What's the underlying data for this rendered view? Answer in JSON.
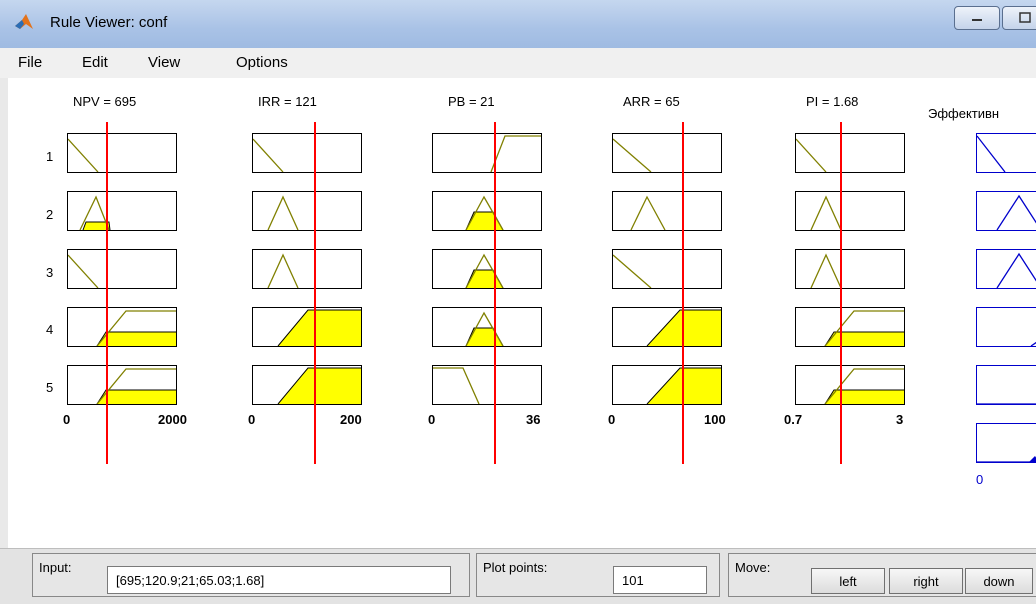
{
  "window": {
    "title": "Rule Viewer: conf"
  },
  "menu": {
    "items": [
      "File",
      "Edit",
      "View",
      "Options"
    ]
  },
  "inputs": [
    {
      "title": "NPV = 695",
      "min": "0",
      "max": "2000"
    },
    {
      "title": "IRR = 121",
      "min": "0",
      "max": "200"
    },
    {
      "title": "PB = 21",
      "min": "0",
      "max": "36"
    },
    {
      "title": "ARR = 65",
      "min": "0",
      "max": "100"
    },
    {
      "title": "PI = 1.68",
      "min": "0.7",
      "max": "3"
    }
  ],
  "output": {
    "title": "Эффективн",
    "min": "0"
  },
  "rules": [
    "1",
    "2",
    "3",
    "4",
    "5"
  ],
  "input_panel": {
    "label": "Input:",
    "value": "[695;120.9;21;65.03;1.68]"
  },
  "plot_points": {
    "label": "Plot points:",
    "value": "101"
  },
  "move": {
    "label": "Move:",
    "buttons": [
      "left",
      "right",
      "down"
    ]
  },
  "colors": {
    "membership": "#808000",
    "fill": "#ffff00",
    "indicator": "#ff0000",
    "output": "#0000cc"
  }
}
